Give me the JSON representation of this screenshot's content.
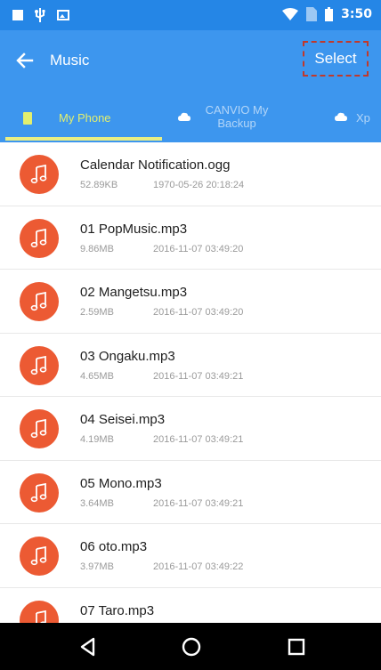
{
  "status_bar": {
    "time": "3:50",
    "icons": [
      "notification-square-icon",
      "usb-icon",
      "image-icon",
      "wifi-icon",
      "no-sim-icon",
      "battery-icon"
    ]
  },
  "app_bar": {
    "title": "Music",
    "select_label": "Select",
    "back_icon": "arrow-left-icon",
    "select_highlight_color": "#c0392b"
  },
  "tabs": [
    {
      "label": "My Phone",
      "icon": "phone-icon",
      "active": true
    },
    {
      "label": "CANVIO My Backup",
      "icon": "cloud-icon",
      "active": false
    },
    {
      "label": "Xp",
      "icon": "cloud-icon",
      "active": false
    }
  ],
  "files": [
    {
      "name": "Calendar Notification.ogg",
      "size": "52.89KB",
      "date": "1970-05-26 20:18:24"
    },
    {
      "name": "01 PopMusic.mp3",
      "size": "9.86MB",
      "date": "2016-11-07 03:49:20"
    },
    {
      "name": "02 Mangetsu.mp3",
      "size": "2.59MB",
      "date": "2016-11-07 03:49:20"
    },
    {
      "name": "03 Ongaku.mp3",
      "size": "4.65MB",
      "date": "2016-11-07 03:49:21"
    },
    {
      "name": "04 Seisei.mp3",
      "size": "4.19MB",
      "date": "2016-11-07 03:49:21"
    },
    {
      "name": "05 Mono.mp3",
      "size": "3.64MB",
      "date": "2016-11-07 03:49:21"
    },
    {
      "name": "06 oto.mp3",
      "size": "3.97MB",
      "date": "2016-11-07 03:49:22"
    },
    {
      "name": "07 Taro.mp3",
      "size": "",
      "date": ""
    }
  ],
  "file_icon": "music-note-icon",
  "nav_bar": {
    "buttons": [
      "back-triangle-icon",
      "home-circle-icon",
      "recents-square-icon"
    ]
  },
  "colors": {
    "status_bar": "#2586e6",
    "app_bar": "#3d96ee",
    "active_tab": "#e2ef6e",
    "file_icon_bg": "#ec5a33"
  }
}
